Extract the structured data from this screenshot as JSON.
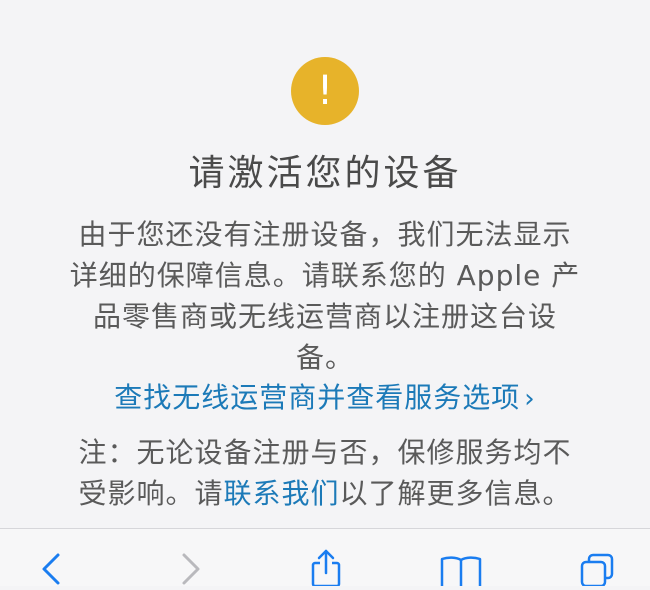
{
  "alert": {
    "icon": "exclamation-icon",
    "icon_glyph": "!",
    "icon_color": "#e7b32a"
  },
  "title": "请激活您的设备",
  "body_lines": [
    "由于您还没有注册设备，我们无法显示",
    "详细的保障信息。请联系您的 Apple 产",
    "品零售商或无线运营商以注册这台设",
    "备。"
  ],
  "carrier_link": {
    "label": "查找无线运营商并查看服务选项",
    "chevron": "›"
  },
  "note": {
    "line1": "注：无论设备注册与否，保修服务均不",
    "line2_prefix": "受影响。请",
    "line2_link": "联系我们",
    "line2_suffix": "以了解更多信息。"
  },
  "toolbar": {
    "items": [
      "back-icon",
      "forward-icon",
      "share-icon",
      "bookmarks-icon",
      "tabs-icon"
    ]
  },
  "colors": {
    "link": "#1c7ab8",
    "text": "#5a5a5a",
    "toolbar_icon": "#1a7df0"
  }
}
